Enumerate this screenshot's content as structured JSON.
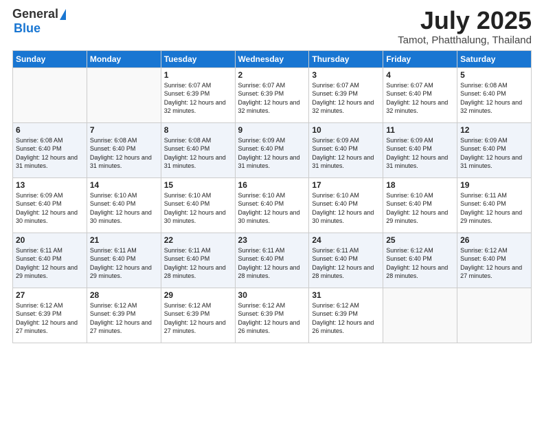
{
  "header": {
    "logo_general": "General",
    "logo_blue": "Blue",
    "month_title": "July 2025",
    "location": "Tamot, Phatthalung, Thailand"
  },
  "days_of_week": [
    "Sunday",
    "Monday",
    "Tuesday",
    "Wednesday",
    "Thursday",
    "Friday",
    "Saturday"
  ],
  "weeks": [
    [
      {
        "day": "",
        "info": ""
      },
      {
        "day": "",
        "info": ""
      },
      {
        "day": "1",
        "info": "Sunrise: 6:07 AM\nSunset: 6:39 PM\nDaylight: 12 hours and 32 minutes."
      },
      {
        "day": "2",
        "info": "Sunrise: 6:07 AM\nSunset: 6:39 PM\nDaylight: 12 hours and 32 minutes."
      },
      {
        "day": "3",
        "info": "Sunrise: 6:07 AM\nSunset: 6:39 PM\nDaylight: 12 hours and 32 minutes."
      },
      {
        "day": "4",
        "info": "Sunrise: 6:07 AM\nSunset: 6:40 PM\nDaylight: 12 hours and 32 minutes."
      },
      {
        "day": "5",
        "info": "Sunrise: 6:08 AM\nSunset: 6:40 PM\nDaylight: 12 hours and 32 minutes."
      }
    ],
    [
      {
        "day": "6",
        "info": "Sunrise: 6:08 AM\nSunset: 6:40 PM\nDaylight: 12 hours and 31 minutes."
      },
      {
        "day": "7",
        "info": "Sunrise: 6:08 AM\nSunset: 6:40 PM\nDaylight: 12 hours and 31 minutes."
      },
      {
        "day": "8",
        "info": "Sunrise: 6:08 AM\nSunset: 6:40 PM\nDaylight: 12 hours and 31 minutes."
      },
      {
        "day": "9",
        "info": "Sunrise: 6:09 AM\nSunset: 6:40 PM\nDaylight: 12 hours and 31 minutes."
      },
      {
        "day": "10",
        "info": "Sunrise: 6:09 AM\nSunset: 6:40 PM\nDaylight: 12 hours and 31 minutes."
      },
      {
        "day": "11",
        "info": "Sunrise: 6:09 AM\nSunset: 6:40 PM\nDaylight: 12 hours and 31 minutes."
      },
      {
        "day": "12",
        "info": "Sunrise: 6:09 AM\nSunset: 6:40 PM\nDaylight: 12 hours and 31 minutes."
      }
    ],
    [
      {
        "day": "13",
        "info": "Sunrise: 6:09 AM\nSunset: 6:40 PM\nDaylight: 12 hours and 30 minutes."
      },
      {
        "day": "14",
        "info": "Sunrise: 6:10 AM\nSunset: 6:40 PM\nDaylight: 12 hours and 30 minutes."
      },
      {
        "day": "15",
        "info": "Sunrise: 6:10 AM\nSunset: 6:40 PM\nDaylight: 12 hours and 30 minutes."
      },
      {
        "day": "16",
        "info": "Sunrise: 6:10 AM\nSunset: 6:40 PM\nDaylight: 12 hours and 30 minutes."
      },
      {
        "day": "17",
        "info": "Sunrise: 6:10 AM\nSunset: 6:40 PM\nDaylight: 12 hours and 30 minutes."
      },
      {
        "day": "18",
        "info": "Sunrise: 6:10 AM\nSunset: 6:40 PM\nDaylight: 12 hours and 29 minutes."
      },
      {
        "day": "19",
        "info": "Sunrise: 6:11 AM\nSunset: 6:40 PM\nDaylight: 12 hours and 29 minutes."
      }
    ],
    [
      {
        "day": "20",
        "info": "Sunrise: 6:11 AM\nSunset: 6:40 PM\nDaylight: 12 hours and 29 minutes."
      },
      {
        "day": "21",
        "info": "Sunrise: 6:11 AM\nSunset: 6:40 PM\nDaylight: 12 hours and 29 minutes."
      },
      {
        "day": "22",
        "info": "Sunrise: 6:11 AM\nSunset: 6:40 PM\nDaylight: 12 hours and 28 minutes."
      },
      {
        "day": "23",
        "info": "Sunrise: 6:11 AM\nSunset: 6:40 PM\nDaylight: 12 hours and 28 minutes."
      },
      {
        "day": "24",
        "info": "Sunrise: 6:11 AM\nSunset: 6:40 PM\nDaylight: 12 hours and 28 minutes."
      },
      {
        "day": "25",
        "info": "Sunrise: 6:12 AM\nSunset: 6:40 PM\nDaylight: 12 hours and 28 minutes."
      },
      {
        "day": "26",
        "info": "Sunrise: 6:12 AM\nSunset: 6:40 PM\nDaylight: 12 hours and 27 minutes."
      }
    ],
    [
      {
        "day": "27",
        "info": "Sunrise: 6:12 AM\nSunset: 6:39 PM\nDaylight: 12 hours and 27 minutes."
      },
      {
        "day": "28",
        "info": "Sunrise: 6:12 AM\nSunset: 6:39 PM\nDaylight: 12 hours and 27 minutes."
      },
      {
        "day": "29",
        "info": "Sunrise: 6:12 AM\nSunset: 6:39 PM\nDaylight: 12 hours and 27 minutes."
      },
      {
        "day": "30",
        "info": "Sunrise: 6:12 AM\nSunset: 6:39 PM\nDaylight: 12 hours and 26 minutes."
      },
      {
        "day": "31",
        "info": "Sunrise: 6:12 AM\nSunset: 6:39 PM\nDaylight: 12 hours and 26 minutes."
      },
      {
        "day": "",
        "info": ""
      },
      {
        "day": "",
        "info": ""
      }
    ]
  ]
}
